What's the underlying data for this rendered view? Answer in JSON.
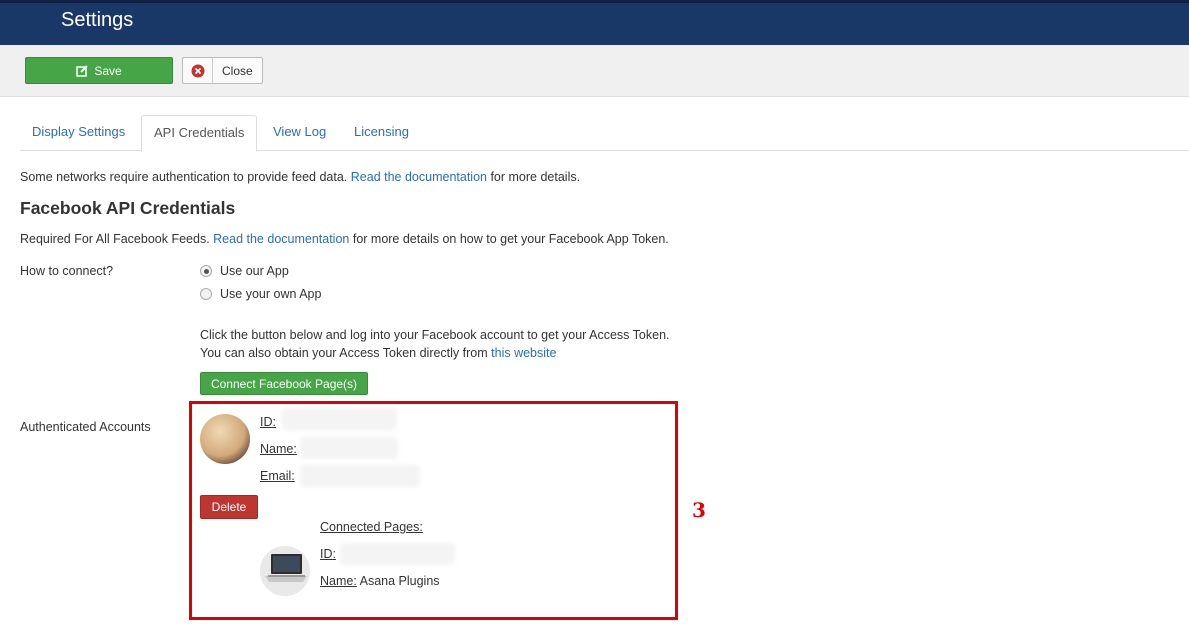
{
  "header": {
    "title": "Settings"
  },
  "toolbar": {
    "save_label": "Save",
    "close_label": "Close"
  },
  "tabs": [
    {
      "label": "Display Settings",
      "active": false
    },
    {
      "label": "API Credentials",
      "active": true
    },
    {
      "label": "View Log",
      "active": false
    },
    {
      "label": "Licensing",
      "active": false
    }
  ],
  "intro": {
    "text_before": "Some networks require authentication to provide feed data. ",
    "link": "Read the documentation",
    "text_after": " for more details."
  },
  "facebook": {
    "heading": "Facebook API Credentials",
    "req_before": "Required For All Facebook Feeds. ",
    "req_link": "Read the documentation",
    "req_after": " for more details on how to get your Facebook App Token.",
    "how_label": "How to connect?",
    "options": [
      {
        "label": "Use our App",
        "checked": true
      },
      {
        "label": "Use your own App",
        "checked": false
      }
    ],
    "info_line1": "Click the button below and log into your Facebook account to get your Access Token.",
    "info_line2_before": "You can also obtain your Access Token directly from ",
    "info_line2_link": "this website",
    "connect_label": "Connect Facebook Page(s)"
  },
  "accounts": {
    "label": "Authenticated Accounts",
    "id_label": "ID:",
    "name_label": "Name:",
    "email_label": "Email:",
    "delete_label": "Delete",
    "connected_pages_label": "Connected Pages:",
    "page_id_label": "ID:",
    "page_name_label": "Name:",
    "page_name_value": "Asana Plugins"
  },
  "annotation_marker": "3",
  "colors": {
    "header": "#1a3867",
    "save": "#46a546",
    "delete": "#bd362f",
    "highlight": "#e00000",
    "link": "#2a6fb5"
  }
}
